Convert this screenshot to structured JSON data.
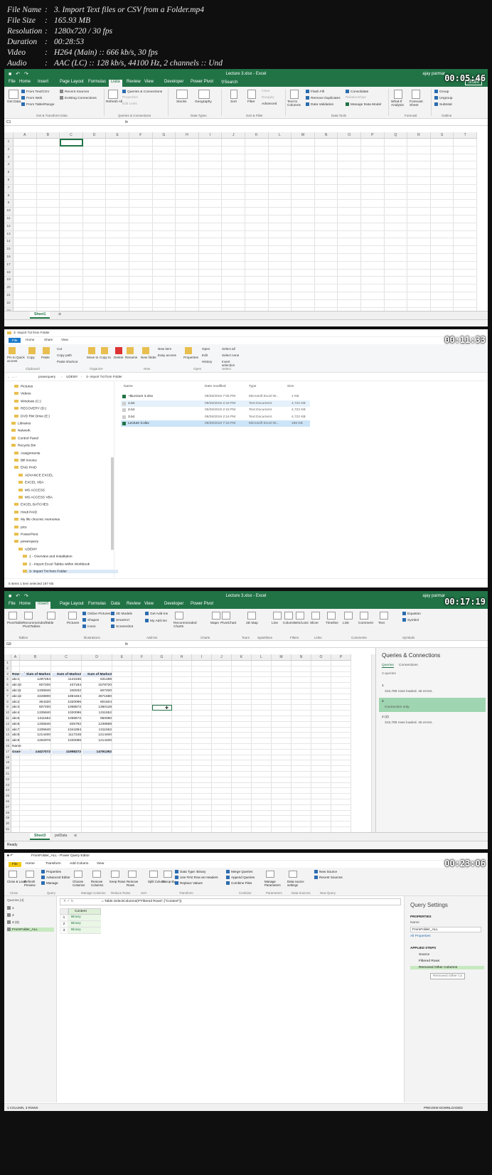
{
  "info": [
    {
      "key": "File Name",
      "value": "3. Import Text files or CSV from a Folder.mp4"
    },
    {
      "key": "File Size",
      "value": "165.93 MB"
    },
    {
      "key": "Resolution",
      "value": "1280x720 / 30 fps"
    },
    {
      "key": "Duration",
      "value": "00:28:53"
    },
    {
      "key": "Video",
      "value": "H264 (Main) :: 666 kb/s, 30 fps"
    },
    {
      "key": "Audio",
      "value": "AAC (LC) :: 128 kb/s, 44100 Hz, 2 channels :: Und"
    }
  ],
  "f1": {
    "timestamp": "00:05:46",
    "title": "Lecture 3.xlsx - Excel",
    "user": "ajay parmar",
    "share": "Share",
    "tabs": [
      "File",
      "Home",
      "Insert",
      "Page Layout",
      "Formulas",
      "Data",
      "Review",
      "View",
      "Developer",
      "Power Pivot"
    ],
    "active_tab": "Data",
    "search": "Search",
    "ribbon": {
      "get_data": "Get Data",
      "from_text": "From Text/CSV",
      "from_web": "From Web",
      "from_table": "From Table/Range",
      "recent": "Recent Sources",
      "existing": "Existing Connections",
      "refresh": "Refresh All",
      "queries": "Queries & Connections",
      "properties": "Properties",
      "edit_links": "Edit Links",
      "stocks": "Stocks",
      "geography": "Geography",
      "sort": "Sort",
      "filter": "Filter",
      "clear": "Clear",
      "reapply": "Reapply",
      "advanced": "Advanced",
      "text_to_columns": "Text to Columns",
      "flash_fill": "Flash Fill",
      "remove_dup": "Remove Duplicates",
      "data_validation": "Data Validation",
      "consolidate": "Consolidate",
      "relationships": "Relationships",
      "manage_model": "Manage Data Model",
      "what_if": "What-If Analysis",
      "forecast": "Forecast Sheet",
      "group": "Group",
      "ungroup": "Ungroup",
      "subtotal": "Subtotal",
      "groups": [
        "Get & Transform Data",
        "Queries & Connections",
        "Data Types",
        "Sort & Filter",
        "Data Tools",
        "Forecast",
        "Outline"
      ]
    },
    "name_box": "C1",
    "fx": "fx",
    "columns": [
      "A",
      "B",
      "C",
      "D",
      "E",
      "F",
      "G",
      "H",
      "I",
      "J",
      "K",
      "L",
      "M",
      "N",
      "O",
      "P",
      "Q",
      "R",
      "S",
      "T"
    ],
    "rows": [
      "1",
      "2",
      "3",
      "4",
      "5",
      "6",
      "7",
      "8",
      "9",
      "10",
      "11",
      "12",
      "13",
      "14",
      "15",
      "16",
      "17",
      "18",
      "19",
      "20",
      "21",
      "22",
      "23"
    ],
    "sheet": "Sheet1"
  },
  "f2": {
    "timestamp": "00:11:33",
    "title": "3- Import Txt from Folder",
    "tabs": [
      "File",
      "Home",
      "Share",
      "View"
    ],
    "ribbon": [
      "Pin to Quick access",
      "Copy",
      "Paste",
      "Cut",
      "Copy path",
      "Paste shortcut",
      "Move to",
      "Copy to",
      "Delete",
      "Rename",
      "New folder",
      "New item",
      "Easy access",
      "Properties",
      "Open",
      "Edit",
      "History",
      "Select all",
      "Select none",
      "Invert selection"
    ],
    "groups": [
      "Clipboard",
      "Organize",
      "New",
      "Open",
      "Select"
    ],
    "path": [
      "powerquery",
      "UDEMY",
      "3- Import Txt from Folder"
    ],
    "headers": [
      "Name",
      "Date modified",
      "Type",
      "Size"
    ],
    "files": [
      {
        "name": "~$Lecture 3.xlsx",
        "date": "09/26/2019 7:05 PM",
        "type": "Microsoft Excel W...",
        "size": "1 KB"
      },
      {
        "name": "1.txt",
        "date": "09/26/2019 2:18 PM",
        "type": "Text Document",
        "size": "4,722 KB"
      },
      {
        "name": "2.txt",
        "date": "09/26/2019 2:18 PM",
        "type": "Text Document",
        "size": "4,722 KB"
      },
      {
        "name": "3.txt",
        "date": "09/26/2019 2:16 PM",
        "type": "Text Document",
        "size": "4,722 KB"
      },
      {
        "name": "Lecture 3.xlsx",
        "date": "09/26/2019 7:15 PM",
        "type": "Microsoft Excel W...",
        "size": "196 KB"
      }
    ],
    "tree": [
      "Pictures",
      "Videos",
      "Windows (C:)",
      "RECOVERY (D:)",
      "DVD RW Drive (E:)",
      "Libraries",
      "Network",
      "Control Panel",
      "Recycle Bin",
      "Assignments",
      "Bill Invoice",
      "ENG PAID",
      "ADVANCE EXCEL",
      "EXCEL VBA",
      "MS ACCESS",
      "MS ACCESS VBA",
      "EXCEL BATCHES",
      "Hindi PAID",
      "My life chocmic memories",
      "pics",
      "PowerPivot",
      "powerquery",
      "UDEMY",
      "1 - Overview and Installation",
      "2 - Import Excel Tables within Workbook",
      "3- Import Txt from Folder"
    ],
    "status": "5 items    1 item selected  197 KB"
  },
  "f3": {
    "timestamp": "00:17:19",
    "title": "Lecture 3.xlsx - Excel",
    "user": "ajay parmar",
    "tabs": [
      "File",
      "Home",
      "Insert",
      "Page Layout",
      "Formulas",
      "Data",
      "Review",
      "View",
      "Developer",
      "Power Pivot"
    ],
    "active_tab": "Insert",
    "ribbon": [
      "PivotTable",
      "Recommended PivotTables",
      "Table",
      "Pictures",
      "Online Pictures",
      "Shapes",
      "Icons",
      "3D Models",
      "SmartArt",
      "Screenshot",
      "Get Add-ins",
      "My Add-ins",
      "Recommended Charts",
      "Maps",
      "PivotChart",
      "3D Map",
      "Line",
      "Column",
      "Win/Loss",
      "Slicer",
      "Timeline",
      "Link",
      "Comment",
      "Text",
      "Equation",
      "Symbol"
    ],
    "groups": [
      "Tables",
      "Illustrations",
      "Add-ins",
      "Charts",
      "Tours",
      "Sparklines",
      "Filters",
      "Links",
      "Comments",
      "Symbols"
    ],
    "name_box": "G9",
    "columns": [
      "A",
      "B",
      "C",
      "D",
      "E",
      "F",
      "G",
      "H",
      "I",
      "J",
      "K",
      "L",
      "M",
      "N",
      "O",
      "P"
    ],
    "pivot_headers": [
      "Row Labels",
      "Sum of Marks1",
      "Sum of Marks2",
      "Sum of Marks3"
    ],
    "pivot_rows": [
      [
        "abc1",
        "1287264",
        "1141536",
        "631488"
      ],
      [
        "abc10",
        "607200",
        "437184",
        "1578720"
      ],
      [
        "abc11",
        "1335840",
        "340032",
        "607200"
      ],
      [
        "abc12",
        "2428800",
        "1894464",
        "2671680"
      ],
      [
        "abc2",
        "364320",
        "1020096",
        "801504"
      ],
      [
        "abc3",
        "607200",
        "1068672",
        "1360128"
      ],
      [
        "abc4",
        "1335840",
        "1020096",
        "1311552"
      ],
      [
        "abc5",
        "1311552",
        "1068672",
        "850080"
      ],
      [
        "abc6",
        "1335840",
        "825792",
        "1238688"
      ],
      [
        "abc7",
        "1335840",
        "1044384",
        "1311552"
      ],
      [
        "abc8",
        "1214400",
        "1117248",
        "1214400"
      ],
      [
        "abc9",
        "1262976",
        "1020096",
        "1214400"
      ],
      [
        "Name",
        "",
        "",
        ""
      ]
    ],
    "grand_total": [
      "Grand Total",
      "14427072",
      "11998272",
      "14791392"
    ],
    "sheets": [
      "Sheet3",
      "pvtData"
    ],
    "status": "Ready",
    "pane": {
      "title": "Queries & Connections",
      "tabs": [
        "Queries",
        "Connections"
      ],
      "count": "3 queries",
      "items": [
        {
          "name": "1",
          "detail": "315,789 rows loaded. 45 errors."
        },
        {
          "name": "2",
          "detail": "Connection only."
        },
        {
          "name": "2 (2)",
          "detail": "315,789 rows loaded. 45 errors."
        }
      ]
    }
  },
  "f4": {
    "timestamp": "00:23:06",
    "title": "FromFolder_ALL - Power Query Editor",
    "tabs": [
      "File",
      "Home",
      "Transform",
      "Add Column",
      "View"
    ],
    "ribbon": [
      "Close & Load",
      "Refresh Preview",
      "Properties",
      "Advanced Editor",
      "Manage",
      "Choose Columns",
      "Remove Columns",
      "Keep Rows",
      "Remove Rows",
      "Split Column",
      "Group By",
      "Data Type: Binary",
      "Use First Row as Headers",
      "Replace Values",
      "Merge Queries",
      "Append Queries",
      "Combine Files",
      "Manage Parameters",
      "Data source settings",
      "New Source",
      "Recent Sources"
    ],
    "groups": [
      "Close",
      "Query",
      "Manage Columns",
      "Reduce Rows",
      "Sort",
      "Transform",
      "Combine",
      "Parameters",
      "Data Sources",
      "New Query"
    ],
    "queries_label": "Queries [4]",
    "queries": [
      "1",
      "2",
      "2 (2)",
      "FromFolder_ALL"
    ],
    "formula": "= Table.SelectColumns(#\"Filtered Rows\",{\"Content\"})",
    "col_header": "Content",
    "rows": [
      "Binary",
      "Binary",
      "Binary"
    ],
    "settings": {
      "title": "Query Settings",
      "properties": "PROPERTIES",
      "name_label": "Name",
      "name_value": "FromFolder_ALL",
      "all_props": "All Properties",
      "applied": "APPLIED STEPS",
      "steps": [
        "Source",
        "Filtered Rows",
        "Removed Other Columns"
      ],
      "tooltip": "Removed Other Co"
    },
    "status_left": "1 COLUMN, 3 ROWS",
    "status_right": "PREVIEW DOWNLOADED"
  }
}
